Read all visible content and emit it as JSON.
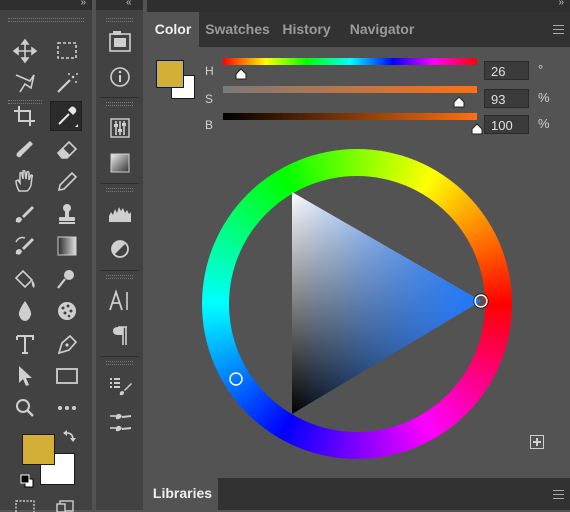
{
  "tabs": [
    {
      "label": "Color"
    },
    {
      "label": "Swatches"
    },
    {
      "label": "History"
    },
    {
      "label": "Navigator"
    }
  ],
  "sliders": [
    {
      "letter": "H",
      "value": "26",
      "unit": "°",
      "fraction": 0.072
    },
    {
      "letter": "S",
      "value": "93",
      "unit": "%",
      "fraction": 0.93
    },
    {
      "letter": "B",
      "value": "100",
      "unit": "%",
      "fraction": 1.0
    }
  ],
  "colors": {
    "foreground": "#d4af37",
    "background": "#ffffff"
  },
  "libraries": {
    "label": "Libraries"
  },
  "tools": [
    "move-tool-icon",
    "marquee-tool-icon",
    "lasso-tool-icon",
    "magic-wand-icon",
    "crop-tool-icon",
    "eyedropper-icon",
    "healing-brush-icon",
    "eraser-icon",
    "hand-tool-icon",
    "pencil-icon",
    "brush-tool-icon",
    "clone-stamp-icon",
    "history-brush-icon",
    "gradient-tool-icon",
    "paint-bucket-icon",
    "dodge-tool-icon",
    "blur-tool-icon",
    "sponge-tool-icon",
    "type-tool-icon",
    "pen-tool-icon",
    "path-selection-icon",
    "rectangle-tool-icon",
    "zoom-tool-icon",
    "more-tools-icon"
  ],
  "panel_icons": [
    "libraries-panel-icon",
    "info-panel-icon",
    "adjustments-panel-icon",
    "gradients-panel-icon",
    "histogram-panel-icon",
    "properties-panel-icon",
    "character-panel-icon",
    "paragraph-panel-icon",
    "brush-settings-icon",
    "brushes-panel-icon"
  ]
}
